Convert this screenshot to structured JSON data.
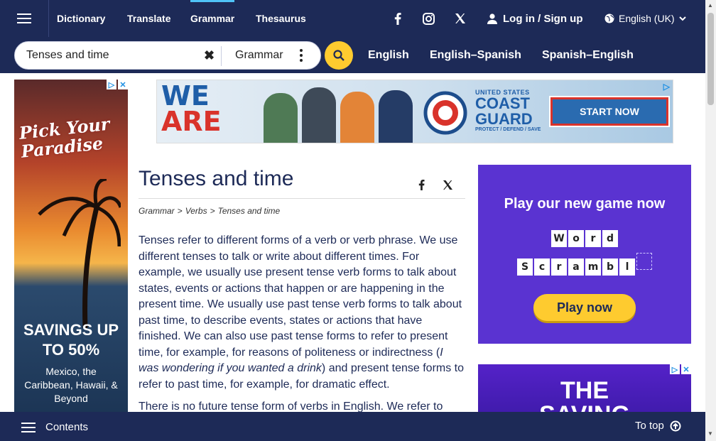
{
  "topnav": {
    "items": [
      {
        "label": "Dictionary"
      },
      {
        "label": "Translate"
      },
      {
        "label": "Grammar"
      },
      {
        "label": "Thesaurus"
      }
    ],
    "login_label": "Log in / Sign up",
    "language_label": "English (UK)"
  },
  "search": {
    "value": "Tenses and time",
    "dictionary_label": "Grammar"
  },
  "dict_links": [
    "English",
    "English–Spanish",
    "Spanish–English"
  ],
  "ads": {
    "left": {
      "brand": "Pick Your Paradise",
      "savings": "SAVINGS UP",
      "savings2": "TO 50%",
      "places": "Mexico, the Caribbean, Hawaii, & Beyond"
    },
    "top": {
      "headline1": "WE",
      "headline2": "ARE",
      "brand_top": "UNITED STATES",
      "brand_main1": "COAST",
      "brand_main2": "GUARD",
      "tagline": "PROTECT / DEFEND / SAVE",
      "cta": "START NOW"
    },
    "right1": {
      "heading": "Play our new game now",
      "word1": [
        "W",
        "o",
        "r",
        "d"
      ],
      "word2": [
        "S",
        "c",
        "r",
        "a",
        "m",
        "b",
        "l",
        ""
      ],
      "cta": "Play now"
    },
    "right2": {
      "heading": "THE",
      "heading2": "SAVING"
    }
  },
  "article": {
    "title": "Tenses and time",
    "breadcrumb": [
      "Grammar",
      ">",
      "Verbs",
      ">",
      "Tenses and time"
    ],
    "para1_a": "Tenses refer to different forms of a verb or verb phrase. We use different tenses to talk or write about different times. For example, we usually use present tense verb forms to talk about states, events or actions that happen or are happening in the present time. We usually use past tense verb forms to talk about past time, to describe events, states or actions that have finished. We can also use past tense forms to refer to present time, for example, for reasons of politeness or indirectness (",
    "para1_italic": "I was wondering if you wanted a drink",
    "para1_b": ") and present tense forms to refer to past time, for example, for dramatic effect.",
    "para2": "There is no future tense form of verbs in English. We refer to"
  },
  "bottombar": {
    "contents_label": "Contents",
    "totop_label": "To top"
  }
}
